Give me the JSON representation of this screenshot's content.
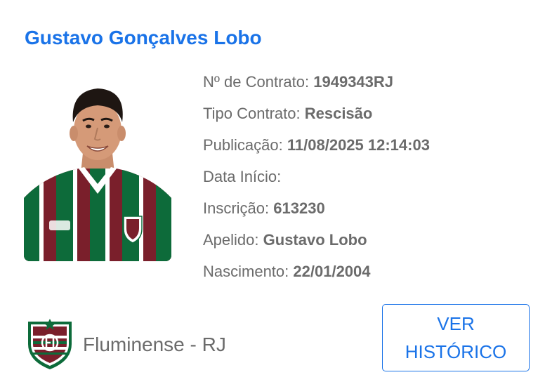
{
  "player": {
    "name": "Gustavo Gonçalves Lobo",
    "photo_alt": "player-photo"
  },
  "details": [
    {
      "label": "Nº de Contrato:",
      "value": "1949343RJ"
    },
    {
      "label": "Tipo Contrato:",
      "value": "Rescisão"
    },
    {
      "label": "Publicação:",
      "value": "11/08/2025 12:14:03"
    },
    {
      "label": "Data Início:",
      "value": ""
    },
    {
      "label": "Inscrição:",
      "value": "613230"
    },
    {
      "label": "Apelido:",
      "value": "Gustavo Lobo"
    },
    {
      "label": "Nascimento:",
      "value": "22/01/2004"
    }
  ],
  "club": {
    "name": "Fluminense - RJ",
    "crest_icon": "fluminense-crest-icon"
  },
  "history_button": {
    "line1": "VER",
    "line2": "HISTÓRICO"
  },
  "colors": {
    "accent": "#1a73e8",
    "text": "#6b6b6b",
    "club_maroon": "#7a1f2b",
    "club_green": "#0d6b3a"
  }
}
